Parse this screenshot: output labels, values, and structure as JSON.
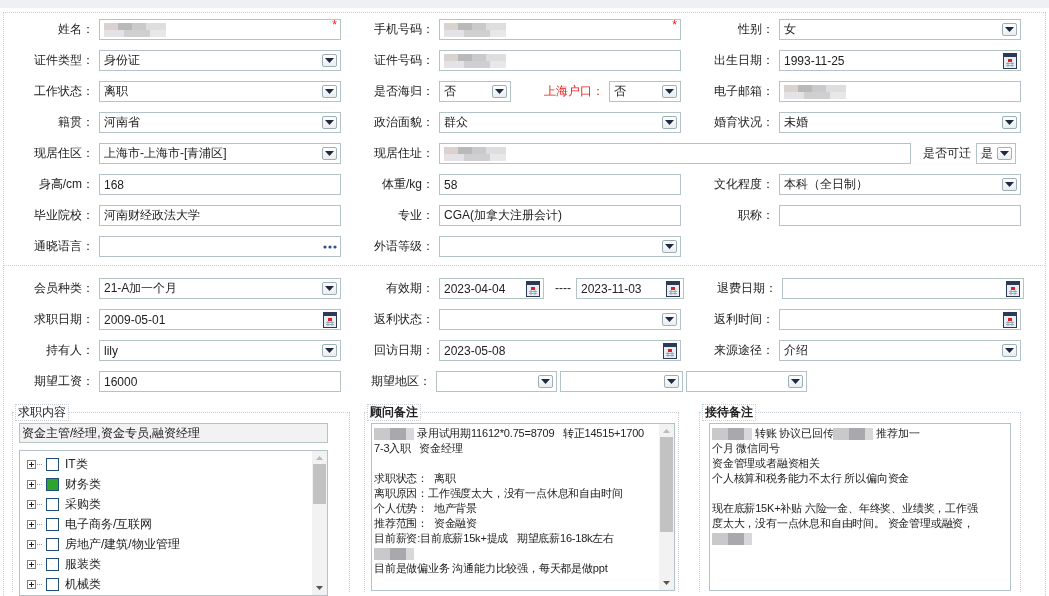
{
  "sections": [
    {
      "rows": [
        [
          [
            {
              "kind": "label",
              "text": "姓名：",
              "highlight": false
            },
            {
              "kind": "text",
              "redacted": true,
              "required_mark": "*"
            }
          ],
          [
            {
              "kind": "label",
              "text": "手机号码：",
              "highlight": false
            },
            {
              "kind": "text",
              "redacted": true,
              "required_mark": "*"
            }
          ],
          [
            {
              "kind": "label",
              "text": "性别：",
              "highlight": false
            },
            {
              "kind": "select",
              "value": "女"
            }
          ]
        ],
        [
          [
            {
              "kind": "label",
              "text": "证件类型：",
              "highlight": false
            },
            {
              "kind": "select",
              "value": "身份证"
            }
          ],
          [
            {
              "kind": "label",
              "text": "证件号码：",
              "highlight": false
            },
            {
              "kind": "text",
              "redacted": true
            }
          ],
          [
            {
              "kind": "label",
              "text": "出生日期：",
              "highlight": false
            },
            {
              "kind": "date",
              "value": "1993-11-25"
            }
          ]
        ],
        [
          [
            {
              "kind": "label",
              "text": "工作状态：",
              "highlight": false
            },
            {
              "kind": "select",
              "value": "离职"
            }
          ],
          [
            {
              "kind": "label",
              "text": "是否海归：",
              "highlight": false
            },
            {
              "kind": "select",
              "value": "否"
            },
            {
              "kind": "label",
              "text": "上海户口：",
              "highlight": true
            },
            {
              "kind": "select",
              "value": "否"
            }
          ],
          [
            {
              "kind": "label",
              "text": "电子邮箱：",
              "highlight": false
            },
            {
              "kind": "text",
              "redacted": true
            }
          ]
        ],
        [
          [
            {
              "kind": "label",
              "text": "籍贯：",
              "highlight": false
            },
            {
              "kind": "select",
              "value": "河南省"
            }
          ],
          [
            {
              "kind": "label",
              "text": "政治面貌：",
              "highlight": false
            },
            {
              "kind": "select",
              "value": "群众"
            }
          ],
          [
            {
              "kind": "label",
              "text": "婚育状况：",
              "highlight": false
            },
            {
              "kind": "select",
              "value": "未婚"
            }
          ]
        ],
        [
          [
            {
              "kind": "label",
              "text": "现居住区：",
              "highlight": false
            },
            {
              "kind": "select",
              "value": "上海市-上海市-[青浦区]"
            }
          ],
          [
            {
              "kind": "label",
              "text": "现居住址：",
              "highlight": false
            },
            {
              "kind": "text",
              "redacted": true
            }
          ],
          [
            {
              "kind": "label",
              "text": "是否可迁",
              "highlight": false
            },
            {
              "kind": "select",
              "value": "是"
            }
          ]
        ],
        [
          [
            {
              "kind": "label",
              "text": "身高/cm：",
              "highlight": false
            },
            {
              "kind": "text",
              "value": "168"
            }
          ],
          [
            {
              "kind": "label",
              "text": "体重/kg：",
              "highlight": false
            },
            {
              "kind": "text",
              "value": "58"
            }
          ],
          [
            {
              "kind": "label",
              "text": "文化程度：",
              "highlight": false
            },
            {
              "kind": "select",
              "value": "本科（全日制）"
            }
          ]
        ],
        [
          [
            {
              "kind": "label",
              "text": "毕业院校：",
              "highlight": false
            },
            {
              "kind": "text",
              "value": "河南财经政法大学"
            }
          ],
          [
            {
              "kind": "label",
              "text": "专业：",
              "highlight": false
            },
            {
              "kind": "text",
              "value": "CGA(加拿大注册会计)"
            }
          ],
          [
            {
              "kind": "label",
              "text": "职称：",
              "highlight": false
            },
            {
              "kind": "text"
            }
          ]
        ],
        [
          [
            {
              "kind": "label",
              "text": "通晓语言：",
              "highlight": false
            },
            {
              "kind": "lookup"
            }
          ],
          [
            {
              "kind": "label",
              "text": "外语等级：",
              "highlight": false
            },
            {
              "kind": "select"
            }
          ]
        ]
      ]
    },
    {
      "rows": [
        [
          [
            {
              "kind": "label",
              "text": "会员种类：",
              "highlight": false
            },
            {
              "kind": "select",
              "value": "21-A加一个月"
            }
          ],
          [
            {
              "kind": "label",
              "text": "有效期：",
              "highlight": false
            },
            {
              "kind": "date",
              "value": "2023-04-04"
            },
            {
              "kind": "label",
              "text": "----",
              "highlight": false
            },
            {
              "kind": "date",
              "value": "2023-11-03"
            }
          ],
          [
            {
              "kind": "label",
              "text": "退费日期：",
              "highlight": false
            },
            {
              "kind": "date"
            }
          ]
        ],
        [
          [
            {
              "kind": "label",
              "text": "求职日期：",
              "highlight": false
            },
            {
              "kind": "date",
              "value": "2009-05-01"
            }
          ],
          [
            {
              "kind": "label",
              "text": "返利状态：",
              "highlight": false
            },
            {
              "kind": "select"
            }
          ],
          [
            {
              "kind": "label",
              "text": "返利时间：",
              "highlight": false
            },
            {
              "kind": "date"
            }
          ]
        ],
        [
          [
            {
              "kind": "label",
              "text": "持有人：",
              "highlight": false
            },
            {
              "kind": "select",
              "value": "lily"
            }
          ],
          [
            {
              "kind": "label",
              "text": "回访日期：",
              "highlight": false
            },
            {
              "kind": "date",
              "value": "2023-05-08"
            }
          ],
          [
            {
              "kind": "label",
              "text": "来源途径：",
              "highlight": false
            },
            {
              "kind": "select",
              "value": "介绍"
            }
          ]
        ],
        [
          [
            {
              "kind": "label",
              "text": "期望工资：",
              "highlight": false
            },
            {
              "kind": "text",
              "value": "16000"
            }
          ],
          [
            {
              "kind": "label",
              "text": "期望地区：",
              "highlight": false
            },
            {
              "kind": "select"
            },
            {
              "kind": "select"
            },
            {
              "kind": "select"
            }
          ]
        ]
      ]
    }
  ],
  "panels": [
    {
      "kind": "job_tree",
      "legend": "求职内容",
      "summary": "资金主管/经理,资金专员,融资经理",
      "tree": [
        {
          "label": "IT类",
          "checked": false,
          "expanded": false
        },
        {
          "label": "财务类",
          "checked": true,
          "expanded": false
        },
        {
          "label": "采购类",
          "checked": false,
          "expanded": false
        },
        {
          "label": "电子商务/互联网",
          "checked": false,
          "expanded": false
        },
        {
          "label": "房地产/建筑/物业管理",
          "checked": false,
          "expanded": false
        },
        {
          "label": "服装类",
          "checked": false,
          "expanded": false
        },
        {
          "label": "机械类",
          "checked": false,
          "expanded": false
        }
      ]
    },
    {
      "kind": "notes",
      "legend": "顾问备注",
      "lines": [
        {
          "kind": "text",
          "segments": [
            {
              "kind": "redacted"
            },
            {
              "kind": "text",
              "text": "录用试用期11612*0.75=8709   转正14515+1700"
            }
          ]
        },
        {
          "kind": "text",
          "segments": [
            {
              "kind": "text",
              "text": "7-3入职   资金经理"
            }
          ]
        },
        {
          "kind": "blank"
        },
        {
          "kind": "text",
          "segments": [
            {
              "kind": "text",
              "text": "求职状态：  离职"
            }
          ]
        },
        {
          "kind": "text",
          "segments": [
            {
              "kind": "text",
              "text": "离职原因：工作强度太大，没有一点休息和自由时间"
            }
          ]
        },
        {
          "kind": "text",
          "segments": [
            {
              "kind": "text",
              "text": "个人优势：  地产背景"
            }
          ]
        },
        {
          "kind": "text",
          "segments": [
            {
              "kind": "text",
              "text": "推荐范围：  资金融资"
            }
          ]
        },
        {
          "kind": "text",
          "segments": [
            {
              "kind": "text",
              "text": "目前薪资:目前底薪15k+提成   期望底薪16-18k左右"
            }
          ]
        },
        {
          "kind": "text",
          "segments": [
            {
              "kind": "redacted"
            }
          ]
        },
        {
          "kind": "text",
          "segments": [
            {
              "kind": "text",
              "text": "目前是做偏业务 沟通能力比较强，每天都是做ppt"
            }
          ]
        }
      ]
    },
    {
      "kind": "notes",
      "legend": "接待备注",
      "lines": [
        {
          "kind": "text",
          "segments": [
            {
              "kind": "redacted"
            },
            {
              "kind": "text",
              "text": "转账 协议已回传"
            },
            {
              "kind": "redacted"
            },
            {
              "kind": "text",
              "text": "推荐加一"
            }
          ]
        },
        {
          "kind": "text",
          "segments": [
            {
              "kind": "text",
              "text": "个月 微信同号"
            }
          ]
        },
        {
          "kind": "text",
          "segments": [
            {
              "kind": "text",
              "text": "资金管理或者融资相关"
            }
          ]
        },
        {
          "kind": "text",
          "segments": [
            {
              "kind": "text",
              "text": "个人核算和税务能力不太行 所以偏向资金"
            }
          ]
        },
        {
          "kind": "blank"
        },
        {
          "kind": "text",
          "segments": [
            {
              "kind": "text",
              "text": "现在底薪15K+补贴 六险一金、年终奖、业绩奖，工作强"
            }
          ]
        },
        {
          "kind": "text",
          "segments": [
            {
              "kind": "text",
              "text": "度太大，没有一点休息和自由时间。 资金管理或融资，"
            }
          ]
        },
        {
          "kind": "text",
          "segments": [
            {
              "kind": "redacted"
            }
          ]
        }
      ]
    }
  ]
}
